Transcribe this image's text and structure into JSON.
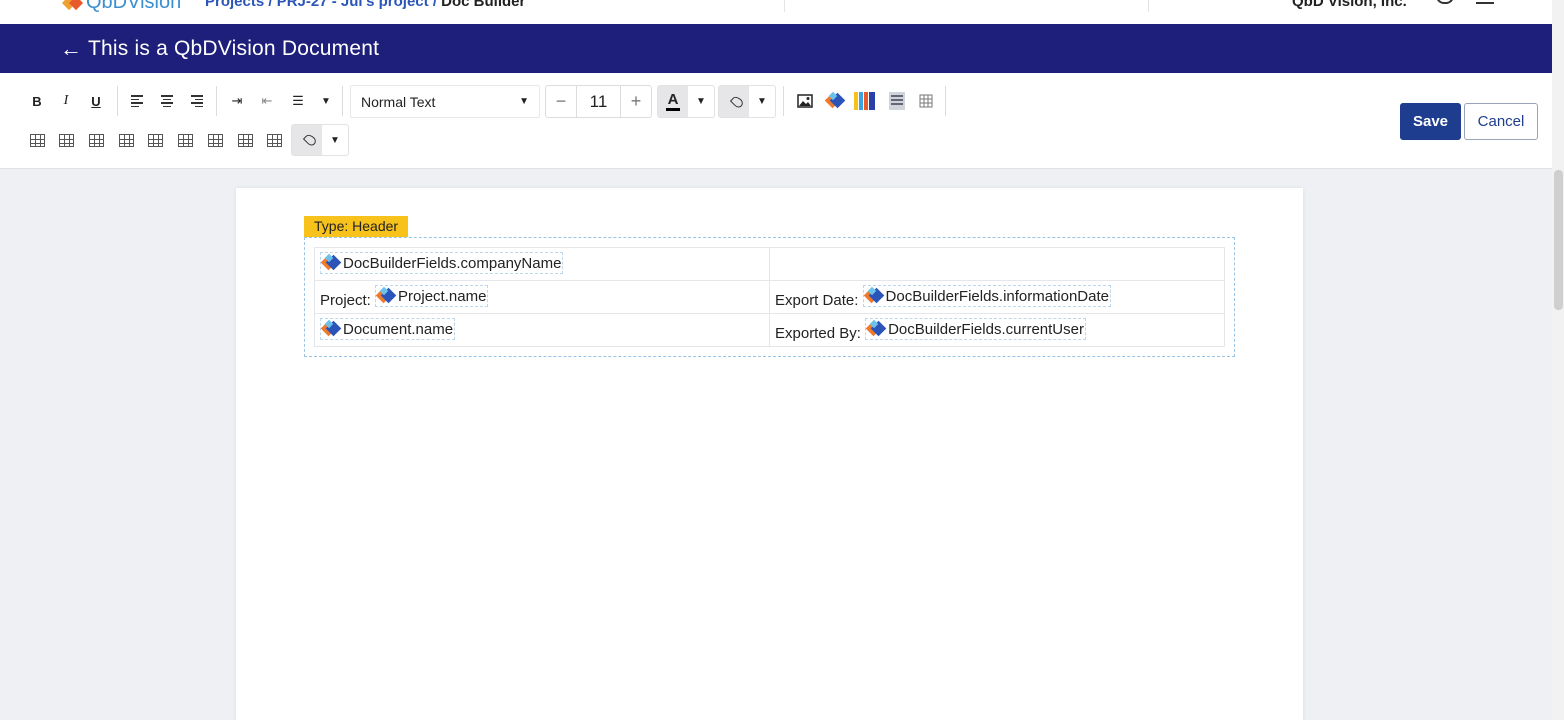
{
  "appbar": {
    "logo_text": "QbDVision",
    "breadcrumb_links": "Projects / PRJ-27 - Jul's project / ",
    "breadcrumb_current": "Doc Builder",
    "company": "QbD Vision, Inc."
  },
  "header": {
    "back_icon": "←",
    "title": "This is a QbDVision Document"
  },
  "toolbar": {
    "bold": "B",
    "italic": "I",
    "underline": "U",
    "paragraph_style": "Normal Text",
    "font_size": "11",
    "minus": "−",
    "plus": "+",
    "font_color_letter": "A",
    "save_label": "Save",
    "cancel_label": "Cancel"
  },
  "document": {
    "type_tag": "Type: Header",
    "rows": [
      {
        "left_label": "",
        "left_field": "DocBuilderFields.companyName",
        "right_label": "",
        "right_field": ""
      },
      {
        "left_label": "Project:",
        "left_field": "Project.name",
        "right_label": "Export Date:",
        "right_field": "DocBuilderFields.informationDate"
      },
      {
        "left_label": "",
        "left_field": "Document.name",
        "right_label": "Exported By:",
        "right_field": "DocBuilderFields.currentUser"
      }
    ]
  },
  "colors": {
    "title_bar": "#1e1f7a",
    "save_button": "#1f3d8f",
    "type_tag": "#f7c21c"
  }
}
